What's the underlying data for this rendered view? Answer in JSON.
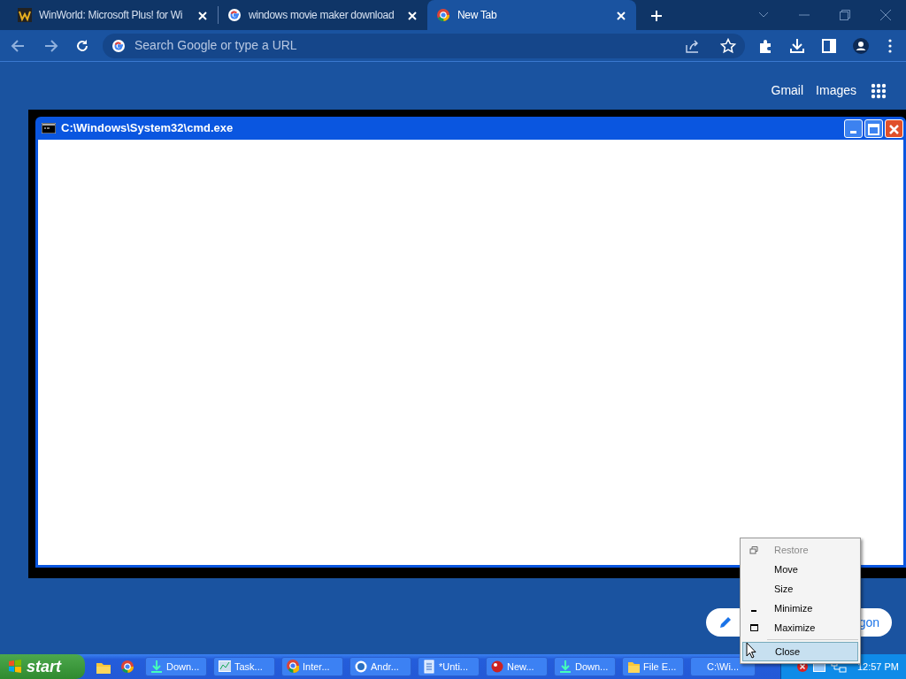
{
  "browser": {
    "tabs": [
      {
        "title": "WinWorld: Microsoft Plus! for Wi",
        "kind": "winworld",
        "selected": false
      },
      {
        "title": "windows movie maker download",
        "kind": "google",
        "selected": false
      },
      {
        "title": "New Tab",
        "kind": "chrome",
        "selected": true
      }
    ],
    "omnibox": {
      "placeholder": "Search Google or type a URL"
    },
    "header_links": [
      "Gmail",
      "Images"
    ]
  },
  "console_window": {
    "title": "C:\\Windows\\System32\\cmd.exe"
  },
  "shortcut_pill": {
    "label": "gon"
  },
  "context_menu": {
    "items": [
      {
        "label": "Restore",
        "kind": "restore",
        "disabled": true,
        "selected": false
      },
      {
        "label": "Move",
        "kind": "plain",
        "disabled": false,
        "selected": false
      },
      {
        "label": "Size",
        "kind": "plain",
        "disabled": false,
        "selected": false
      },
      {
        "label": "Minimize",
        "kind": "minimize",
        "disabled": false,
        "selected": false
      },
      {
        "label": "Maximize",
        "kind": "maximize",
        "disabled": false,
        "selected": false
      },
      {
        "label": "Close",
        "kind": "separated",
        "disabled": false,
        "selected": true
      }
    ]
  },
  "taskbar": {
    "start_label": "start",
    "buttons": [
      {
        "label": "Down...",
        "kind": "download"
      },
      {
        "label": "Task...",
        "kind": "taskmgr"
      },
      {
        "label": "Inter...",
        "kind": "chrome"
      },
      {
        "label": "Andr...",
        "kind": "android"
      },
      {
        "label": "*Unti...",
        "kind": "notepad"
      },
      {
        "label": "New...",
        "kind": "redball"
      },
      {
        "label": "Down...",
        "kind": "download"
      },
      {
        "label": "File E...",
        "kind": "folder"
      },
      {
        "label": "C:\\Wi...",
        "kind": "none"
      }
    ],
    "clock": "12:57 PM"
  }
}
